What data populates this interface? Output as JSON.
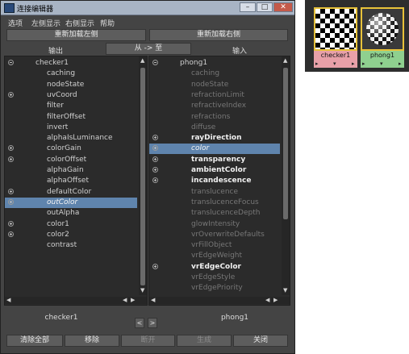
{
  "window": {
    "title": "连接编辑器",
    "controls": {
      "minimize": "–",
      "maximize": "□",
      "close": "✕"
    }
  },
  "menu": [
    "选项",
    "左侧显示",
    "右侧显示",
    "帮助"
  ],
  "top_buttons": {
    "reload_left": "重新加载左侧",
    "reload_right": "重新加载右侧",
    "outputs": "输出",
    "direction": "从 -> 至",
    "inputs": "输入"
  },
  "left_panel": {
    "node": "checker1",
    "attributes": [
      {
        "label": "caching",
        "expand": "",
        "style": "norm"
      },
      {
        "label": "nodeState",
        "expand": "",
        "style": "norm"
      },
      {
        "label": "uvCoord",
        "expand": "plus",
        "style": "norm"
      },
      {
        "label": "filter",
        "expand": "",
        "style": "norm"
      },
      {
        "label": "filterOffset",
        "expand": "",
        "style": "norm"
      },
      {
        "label": "invert",
        "expand": "",
        "style": "norm"
      },
      {
        "label": "alphaIsLuminance",
        "expand": "",
        "style": "norm"
      },
      {
        "label": "colorGain",
        "expand": "plus",
        "style": "norm"
      },
      {
        "label": "colorOffset",
        "expand": "plus",
        "style": "norm"
      },
      {
        "label": "alphaGain",
        "expand": "",
        "style": "norm"
      },
      {
        "label": "alphaOffset",
        "expand": "",
        "style": "norm"
      },
      {
        "label": "defaultColor",
        "expand": "plus",
        "style": "norm"
      },
      {
        "label": "outColor",
        "expand": "plus",
        "style": "ital",
        "selected": true
      },
      {
        "label": "outAlpha",
        "expand": "",
        "style": "norm"
      },
      {
        "label": "color1",
        "expand": "plus",
        "style": "norm"
      },
      {
        "label": "color2",
        "expand": "plus",
        "style": "norm"
      },
      {
        "label": "contrast",
        "expand": "",
        "style": "norm"
      }
    ]
  },
  "right_panel": {
    "node": "phong1",
    "attributes": [
      {
        "label": "caching",
        "expand": "",
        "style": "dim"
      },
      {
        "label": "nodeState",
        "expand": "",
        "style": "dim"
      },
      {
        "label": "refractionLimit",
        "expand": "",
        "style": "dim"
      },
      {
        "label": "refractiveIndex",
        "expand": "",
        "style": "dim"
      },
      {
        "label": "refractions",
        "expand": "",
        "style": "dim"
      },
      {
        "label": "diffuse",
        "expand": "",
        "style": "dim"
      },
      {
        "label": "rayDirection",
        "expand": "plus",
        "style": "bold"
      },
      {
        "label": "color",
        "expand": "plus",
        "style": "ital",
        "selected": true
      },
      {
        "label": "transparency",
        "expand": "plus",
        "style": "bold"
      },
      {
        "label": "ambientColor",
        "expand": "plus",
        "style": "bold"
      },
      {
        "label": "incandescence",
        "expand": "plus",
        "style": "bold"
      },
      {
        "label": "translucence",
        "expand": "",
        "style": "dim"
      },
      {
        "label": "translucenceFocus",
        "expand": "",
        "style": "dim"
      },
      {
        "label": "translucenceDepth",
        "expand": "",
        "style": "dim"
      },
      {
        "label": "glowIntensity",
        "expand": "",
        "style": "dim"
      },
      {
        "label": "vrOverwriteDefaults",
        "expand": "",
        "style": "dim"
      },
      {
        "label": "vrFillObject",
        "expand": "",
        "style": "dim"
      },
      {
        "label": "vrEdgeWeight",
        "expand": "",
        "style": "dim"
      },
      {
        "label": "vrEdgeColor",
        "expand": "plus",
        "style": "bold"
      },
      {
        "label": "vrEdgeStyle",
        "expand": "",
        "style": "dim"
      },
      {
        "label": "vrEdgePriority",
        "expand": "",
        "style": "dim"
      }
    ]
  },
  "footer": {
    "left_node": "checker1",
    "right_node": "phong1",
    "prev": "<",
    "next": ">",
    "clear_all": "清除全部",
    "remove": "移除",
    "break": "断开",
    "make": "生成",
    "close": "关闭"
  },
  "hypershade": {
    "nodes": [
      {
        "label": "checker1",
        "color": "#e8a0a8",
        "swatch": "checker"
      },
      {
        "label": "phong1",
        "color": "#8fd08f",
        "swatch": "sphere"
      }
    ]
  },
  "colors": {
    "selection": "#5f84ad",
    "panel_bg": "#2b2b2b",
    "window_bg": "#444444"
  }
}
